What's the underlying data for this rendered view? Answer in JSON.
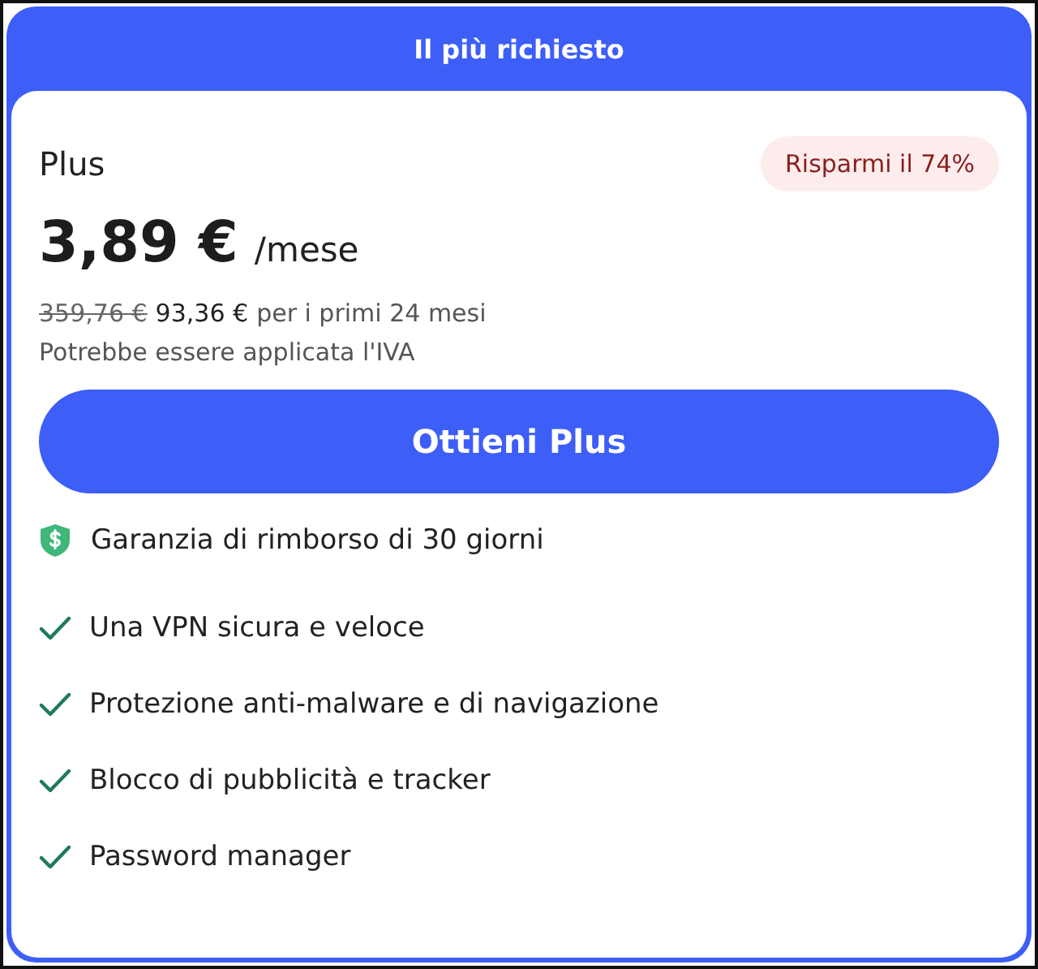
{
  "banner": {
    "label": "Il più richiesto"
  },
  "plan": {
    "name": "Plus",
    "badge": "Risparmi il 74%",
    "price": "3,89 €",
    "unit": "/mese",
    "old_price": "359,76 €",
    "new_price": "93,36 €",
    "price_note": "per i primi 24 mesi",
    "tax_note": "Potrebbe essere applicata l'IVA"
  },
  "button": {
    "label": "Ottieni Plus"
  },
  "guarantee": "Garanzia di rimborso di 30 giorni",
  "features": [
    {
      "label": "Una VPN sicura e veloce"
    },
    {
      "label": "Protezione anti-malware e di navigazione"
    },
    {
      "label": "Blocco di pubblicità e tracker"
    },
    {
      "label": "Password manager"
    }
  ]
}
